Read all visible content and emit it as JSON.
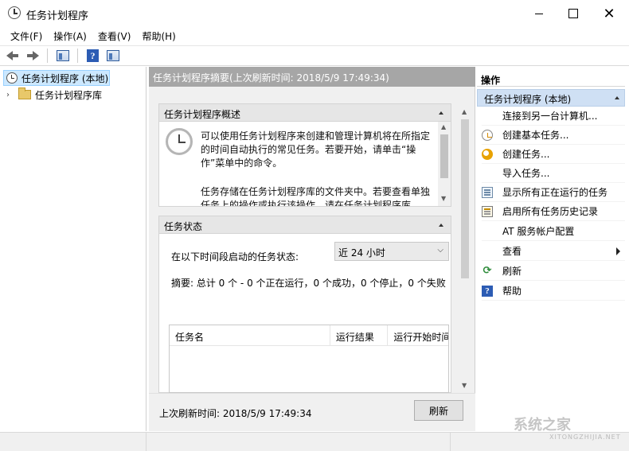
{
  "window": {
    "title": "任务计划程序"
  },
  "menu": [
    "文件(F)",
    "操作(A)",
    "查看(V)",
    "帮助(H)"
  ],
  "tree": {
    "root_label": "任务计划程序 (本地)",
    "child_label": "任务计划程序库"
  },
  "center": {
    "header": "任务计划程序摘要(上次刷新时间: 2018/5/9 17:49:34)",
    "overview": {
      "title": "任务计划程序概述",
      "text1": "可以使用任务计划程序来创建和管理计算机将在所指定的时间自动执行的常见任务。若要开始，请单击“操作”菜单中的命令。",
      "text2": "任务存储在任务计划程序库的文件夹中。若要查看单独任务上的操作或执行该操作，请在任务计划程序库"
    },
    "status": {
      "title": "任务状态",
      "period_label": "在以下时间段启动的任务状态:",
      "period_value": "近 24 小时",
      "summary": "摘要: 总计 0 个 - 0 个正在运行，0 个成功，0 个停止，0 个失败",
      "columns": [
        "任务名",
        "运行结果",
        "运行开始时间"
      ]
    },
    "footer": {
      "last_refresh": "上次刷新时间: 2018/5/9 17:49:34",
      "refresh_button": "刷新"
    }
  },
  "actions": {
    "title": "操作",
    "group": "任务计划程序 (本地)",
    "items": [
      {
        "label": "连接到另一台计算机...",
        "icon": "blank"
      },
      {
        "label": "创建基本任务...",
        "icon": "wizard-icon"
      },
      {
        "label": "创建任务...",
        "icon": "create-task-icon"
      },
      {
        "label": "导入任务...",
        "icon": "blank"
      },
      {
        "label": "显示所有正在运行的任务",
        "icon": "running-tasks-icon"
      },
      {
        "label": "启用所有任务历史记录",
        "icon": "history-icon"
      },
      {
        "label": "AT 服务帐户配置",
        "icon": "blank"
      },
      {
        "label": "查看",
        "icon": "blank"
      },
      {
        "label": "刷新",
        "icon": "refresh-icon"
      },
      {
        "label": "帮助",
        "icon": "help-icon"
      }
    ]
  },
  "watermark": {
    "main": "系统之家",
    "sub": "XITONGZHIJIA.NET"
  }
}
